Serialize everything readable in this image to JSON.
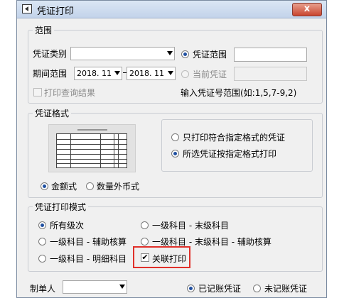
{
  "window": {
    "title": "凭证打印",
    "close_label": "x"
  },
  "range": {
    "legend": "范围",
    "voucher_type_label": "凭证类别",
    "voucher_type_value": "",
    "period_label": "期间范围",
    "period_from": "2018. 11",
    "period_to": "2018. 11",
    "voucher_range_label": "凭证范围",
    "voucher_range_value": "",
    "current_voucher_label": "当前凭证",
    "print_query_label": "打印查询结果",
    "hint": "输入凭证号范围(如:1,5,7-9,2)"
  },
  "format": {
    "legend": "凭证格式",
    "option_specified_only": "只打印符合指定格式的凭证",
    "option_selected": "所选凭证按指定格式打印",
    "amount_label": "金额式",
    "quantity_label": "数量外币式"
  },
  "mode": {
    "legend": "凭证打印模式",
    "all_levels": "所有级次",
    "first_last": "一级科目 - 末级科目",
    "first_aux": "一级科目 - 辅助核算",
    "first_last_aux": "一级科目 - 末级科目 - 辅助核算",
    "first_detail": "一级科目 - 明细科目",
    "linked_print": "关联打印"
  },
  "footer": {
    "maker_label": "制单人",
    "maker_value": "",
    "posted_label": "已记账凭证",
    "unposted_label": "未记账凭证"
  }
}
